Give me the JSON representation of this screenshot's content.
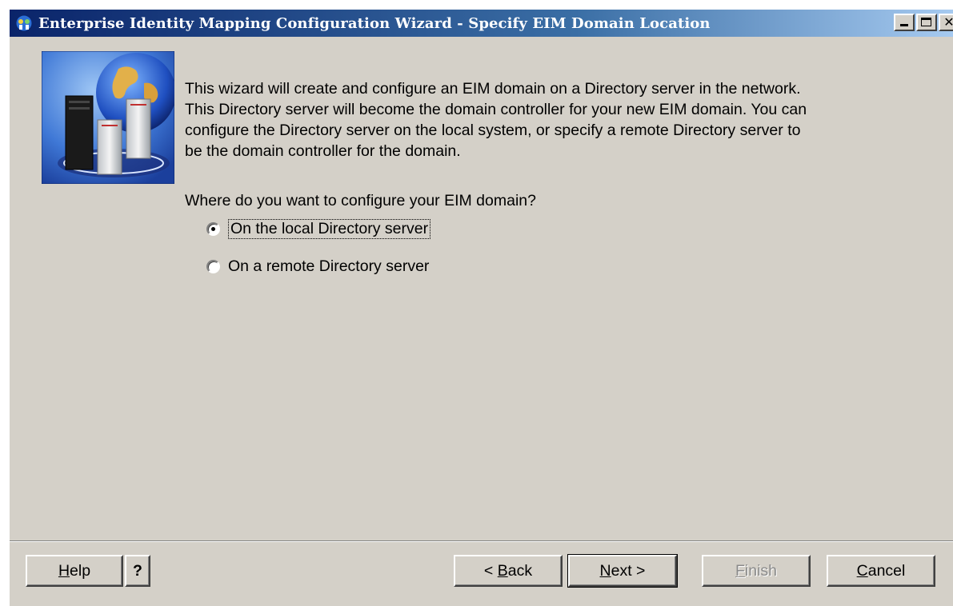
{
  "window": {
    "title": "Enterprise Identity Mapping Configuration Wizard - Specify EIM Domain Location",
    "icon": "eim-wizard-icon",
    "controls": {
      "minimize": "minimize-icon",
      "maximize": "maximize-icon",
      "close": "close-icon"
    }
  },
  "intro": {
    "lines": [
      "This wizard will create and configure an EIM domain on a Directory server in the network.",
      "This Directory server will become the domain controller for your new EIM domain.  You can",
      "configure the Directory server on the local system, or specify a remote Directory server to",
      "be the domain controller for the domain."
    ]
  },
  "question": "Where do you want to configure your EIM domain?",
  "options": [
    {
      "label": "On the local Directory server",
      "selected": true
    },
    {
      "label": "On a remote Directory server",
      "selected": false
    }
  ],
  "buttons": {
    "help": {
      "mnemonic": "H",
      "rest": "elp"
    },
    "help_question": "?",
    "back": {
      "prefix": "< ",
      "mnemonic": "B",
      "rest": "ack"
    },
    "next": {
      "mnemonic": "N",
      "rest": "ext >"
    },
    "finish": {
      "mnemonic": "F",
      "rest": "inish",
      "disabled": true
    },
    "cancel": {
      "mnemonic": "C",
      "rest": "ancel"
    }
  },
  "colors": {
    "titlebar_start": "#0a246a",
    "titlebar_end": "#a6caf0",
    "dialog_background": "#d4d0c8"
  }
}
